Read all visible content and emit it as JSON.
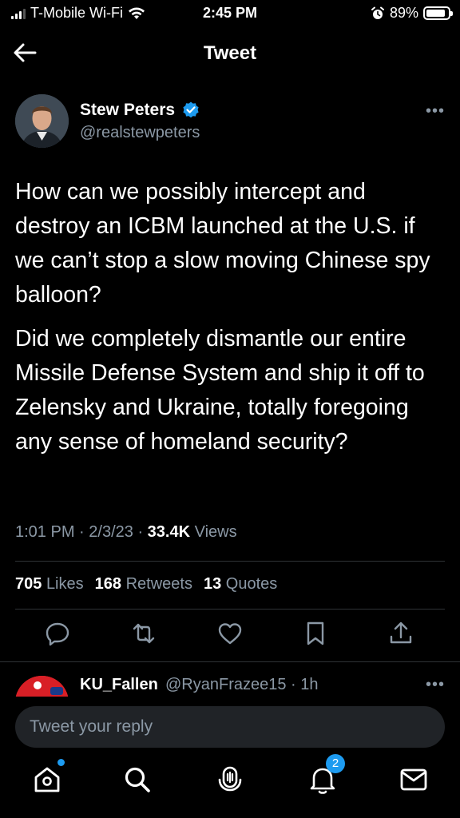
{
  "status_bar": {
    "carrier": "T-Mobile Wi-Fi",
    "time": "2:45 PM",
    "battery": "89%",
    "battery_level": 0.89
  },
  "header": {
    "title": "Tweet"
  },
  "author": {
    "name": "Stew Peters",
    "handle": "@realstewpeters",
    "verified": true
  },
  "tweet": {
    "paragraphs": [
      "How can we possibly intercept and destroy an ICBM launched at the U.S. if we can’t stop a slow moving Chinese spy balloon?",
      "Did we completely dismantle our entire Missile Defense System and ship it off to Zelensky and Ukraine, totally foregoing any sense of homeland security?"
    ],
    "time": "1:01 PM",
    "date": "2/3/23",
    "views_count": "33.4K",
    "views_label": "Views"
  },
  "stats": {
    "likes_count": "705",
    "likes_label": "Likes",
    "retweets_count": "168",
    "retweets_label": "Retweets",
    "quotes_count": "13",
    "quotes_label": "Quotes"
  },
  "reply_preview": {
    "name": "KU_Fallen",
    "handle_time": "@RyanFrazee15 · 1h"
  },
  "reply_box": {
    "placeholder": "Tweet your reply"
  },
  "tab_bar": {
    "notifications_badge": "2"
  },
  "colors": {
    "background": "#000000",
    "text": "#e7e9ea",
    "secondary": "#8b98a5",
    "accent": "#1d9bf0",
    "divider": "#2f3336"
  },
  "icons": [
    "back-arrow-icon",
    "verified-badge-icon",
    "more-icon",
    "reply-icon",
    "retweet-icon",
    "like-icon",
    "bookmark-icon",
    "share-icon",
    "home-icon",
    "search-icon",
    "spaces-icon",
    "notifications-icon",
    "messages-icon"
  ]
}
